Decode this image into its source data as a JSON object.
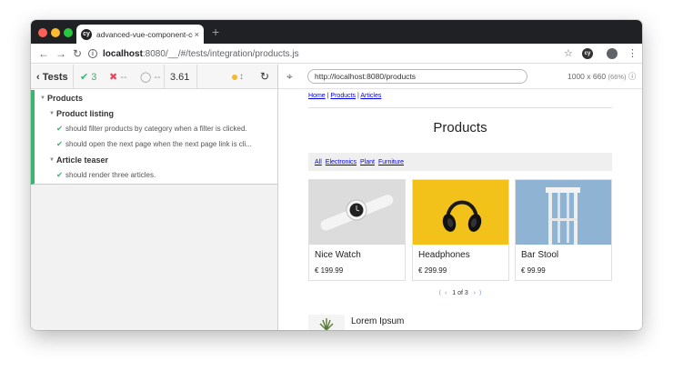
{
  "browser": {
    "tab_title": "advanced-vue-component-co",
    "tab_close": "×",
    "new_tab": "+",
    "favicon": "cy",
    "url_host": "localhost",
    "url_port": ":8080",
    "url_path": "/__/#/tests/integration/products.js",
    "icons": [
      "back-arrow-icon",
      "forward-arrow-icon",
      "reload-icon",
      "info-icon",
      "star-icon",
      "cypress-extension-icon",
      "profile-icon",
      "more-icon"
    ]
  },
  "reporter": {
    "tests_label": "Tests",
    "passed_count": "3",
    "failed_count": "--",
    "pending_count": "--",
    "duration": "3.61",
    "tree": {
      "suite": "Products",
      "groups": [
        {
          "title": "Product listing",
          "tests": [
            "should filter products by category when a filter is clicked.",
            "should open the next page when the next page link is cli..."
          ]
        },
        {
          "title": "Article teaser",
          "tests": [
            "should render three articles."
          ]
        }
      ]
    }
  },
  "aut": {
    "url": "http://localhost:8080/products",
    "viewport": "1000 x 660",
    "scale": "(66%)"
  },
  "app": {
    "breadcrumb": [
      "Home",
      "Products",
      "Articles"
    ],
    "breadcrumb_sep": "|",
    "title": "Products",
    "filters": [
      "All",
      "Electronics",
      "Plant",
      "Furniture"
    ],
    "products": [
      {
        "name": "Nice Watch",
        "price": "€ 199.99",
        "bg": "#dcdcdc"
      },
      {
        "name": "Headphones",
        "price": "€ 299.99",
        "bg": "#f2c21b"
      },
      {
        "name": "Bar Stool",
        "price": "€ 99.99",
        "bg": "#8fb3d2"
      }
    ],
    "pagination": {
      "first": "⟨",
      "prev": "‹",
      "page_text": "1 of 3",
      "next": "›",
      "last": "⟩"
    },
    "teaser_title": "Lorem Ipsum"
  },
  "colors": {
    "pass": "#3bb46e",
    "fail": "#e8465f",
    "link": "#0000ee",
    "titlebar": "#202124"
  }
}
